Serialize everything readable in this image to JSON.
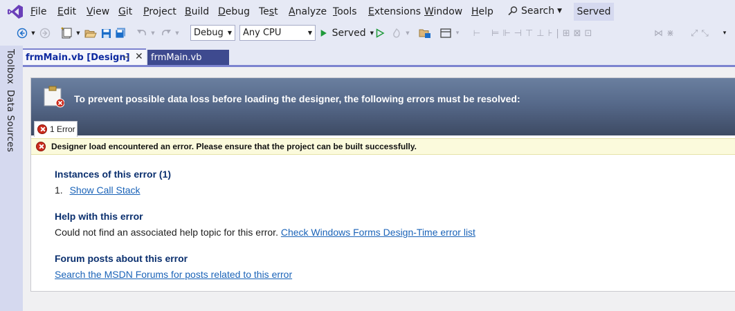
{
  "menubar": {
    "items": [
      {
        "label": "File",
        "accel": "F",
        "rest": "ile"
      },
      {
        "label": "Edit",
        "accel": "E",
        "rest": "dit"
      },
      {
        "label": "View",
        "accel": "V",
        "rest": "iew"
      },
      {
        "label": "Git",
        "accel": "G",
        "rest": "it"
      },
      {
        "label": "Project",
        "accel": "P",
        "rest": "roject"
      },
      {
        "label": "Build",
        "accel": "B",
        "rest": "uild"
      },
      {
        "label": "Debug",
        "accel": "D",
        "rest": "ebug"
      },
      {
        "label": "Test",
        "pre": "Te",
        "accel": "s",
        "rest": "t"
      },
      {
        "label": "Analyze",
        "accel": "A",
        "rest": "nalyze"
      },
      {
        "label": "Tools",
        "accel": "T",
        "rest": "ools"
      },
      {
        "label": "Extensions",
        "accel": "E",
        "rest": "xtensions"
      },
      {
        "label": "Window",
        "accel": "W",
        "rest": "indow"
      },
      {
        "label": "Help",
        "accel": "H",
        "rest": "elp"
      }
    ],
    "search_label": "Search",
    "solution_badge": "Served"
  },
  "toolbar": {
    "configuration": "Debug",
    "platform": "Any CPU",
    "start_project": "Served",
    "icons": [
      "back-icon",
      "forward-icon",
      "new-project-icon",
      "open-folder-icon",
      "save-icon",
      "save-all-icon",
      "undo-icon",
      "redo-icon",
      "start-icon",
      "start-without-debugging-icon",
      "hot-reload-icon"
    ]
  },
  "tool_windows": {
    "toolbox": "Toolbox",
    "data_sources": "Data Sources"
  },
  "tabs": {
    "active": "frmMain.vb [Design]",
    "inactive": "frmMain.vb"
  },
  "designer_error": {
    "header": "To prevent possible data loss before loading the designer, the following errors must be resolved:",
    "error_count_tab": "1 Error",
    "error_message": "Designer load encountered an error. Please ensure that the project can be built successfully.",
    "instances_title": "Instances of this error (1)",
    "instance_number": "1.",
    "instance_link": "Show Call Stack",
    "help_title": "Help with this error",
    "help_text": "Could not find an associated help topic for this error.",
    "help_link": "Check Windows Forms Design-Time error list",
    "forum_title": "Forum posts about this error",
    "forum_link": "Search the MSDN Forums for posts related to this error"
  },
  "colors": {
    "accent": "#7c83cf",
    "header_top": "#6a7f9f",
    "header_bottom": "#3d4a63",
    "link": "#1a63b8",
    "error": "#cc2b1d"
  }
}
